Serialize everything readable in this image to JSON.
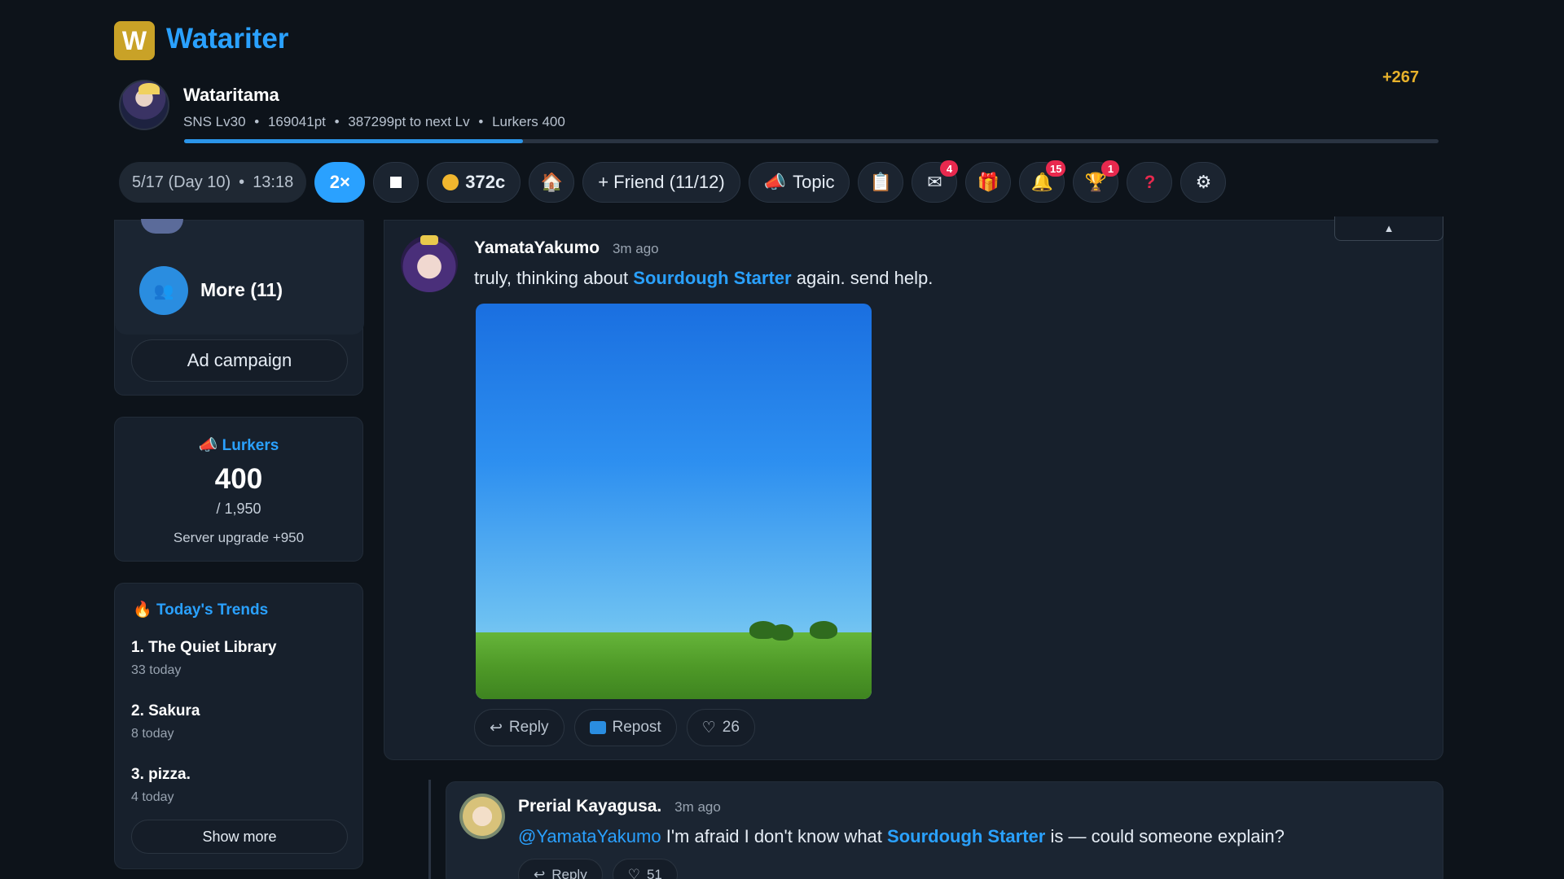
{
  "app": {
    "logo_letter": "W",
    "title": "Watariter"
  },
  "user": {
    "name": "Wataritama",
    "level": "SNS Lv30",
    "points": "169041pt",
    "to_next": "387299pt to next Lv",
    "lurkers": "Lurkers 400",
    "separator": "•",
    "level_progress_percent": 27,
    "score_gain": "+267"
  },
  "toolbar": {
    "date": "5/17 (Day 10)",
    "time": "13:18",
    "speed": "2×",
    "coins": "372c",
    "friend": "+ Friend (11/12)",
    "topic": "Topic",
    "mail_badge": "4",
    "notifications_badge": "15",
    "trophy_badge": "1"
  },
  "sidebar": {
    "more_label": "More (11)",
    "ad_campaign": "Ad campaign",
    "lurkers": {
      "title": "Lurkers",
      "value": "400",
      "max": "/ 1,950",
      "upgrade": "Server upgrade +950"
    },
    "trends": {
      "title": "Today's Trends",
      "items": [
        {
          "name": "1. The Quiet Library",
          "count": "33 today"
        },
        {
          "name": "2. Sakura",
          "count": "8 today"
        },
        {
          "name": "3. pizza.",
          "count": "4 today"
        }
      ],
      "show_more": "Show more"
    }
  },
  "feed": {
    "scroll_top": "▲",
    "post": {
      "author": "YamataYakumo",
      "time": "3m ago",
      "text_before": "truly, thinking about ",
      "topic_link": "Sourdough Starter",
      "text_after": " again. send help.",
      "reply": "Reply",
      "repost": "Repost",
      "likes": "26"
    },
    "reply": {
      "author": "Prerial Kayagusa.",
      "time": "3m ago",
      "mention": "@YamataYakumo",
      "text_mid": " I'm afraid I don't know what ",
      "topic_link": "Sourdough Starter",
      "text_after": " is — could someone explain?",
      "reply": "Reply",
      "likes": "51"
    }
  }
}
